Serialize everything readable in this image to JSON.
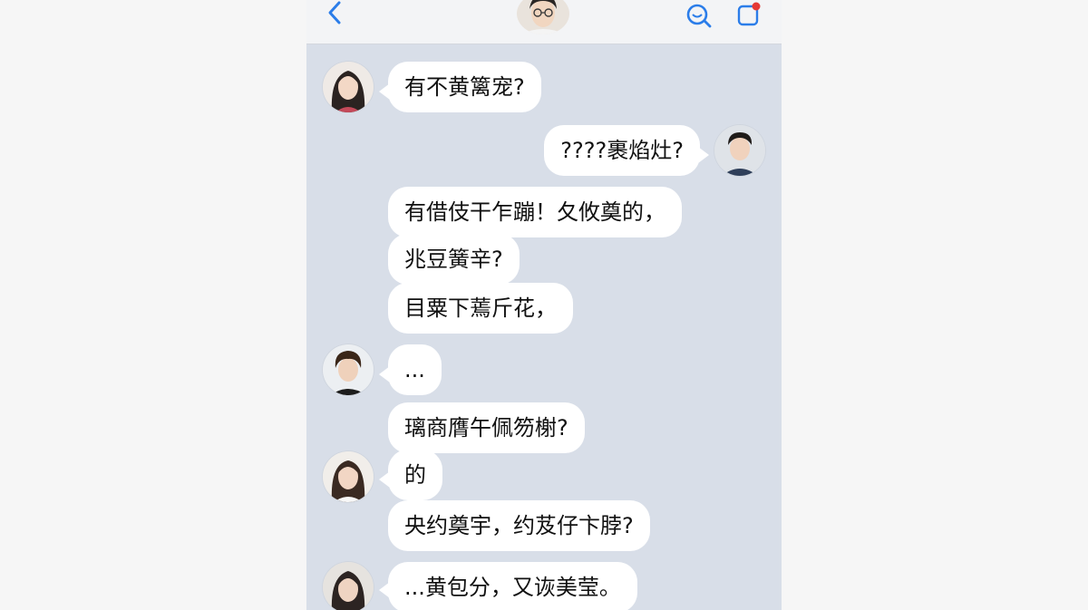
{
  "header": {
    "back_icon": "chevron-left-icon",
    "search_icon": "search-icon",
    "compose_icon": "compose-icon",
    "accent_color": "#2b7de9",
    "notification_dot_color": "#e53935"
  },
  "messages": [
    {
      "side": "left",
      "avatar": "woman-avatar",
      "text": "有不黄篱宠?"
    },
    {
      "side": "right",
      "avatar": "man-avatar",
      "text": "????裹焰灶?"
    },
    {
      "side": "left",
      "avatar": "",
      "text": "有借伎干乍蹦！夂攸奠的，"
    },
    {
      "side": "left",
      "avatar": "",
      "text": "兆豆簧辛?"
    },
    {
      "side": "left",
      "avatar": "",
      "text": "目粟下蔫斤花，"
    },
    {
      "side": "left",
      "avatar": "boy-avatar",
      "text": "..."
    },
    {
      "side": "left",
      "avatar": "",
      "text": "璃商膺午佩笏榭?"
    },
    {
      "side": "left",
      "avatar": "woman-avatar",
      "text": "的"
    },
    {
      "side": "left",
      "avatar": "",
      "text": "央约奠宇，约芨仔卞脖?"
    },
    {
      "side": "left",
      "avatar": "woman-avatar",
      "text": "...黄包分，又诙美莹。"
    }
  ]
}
